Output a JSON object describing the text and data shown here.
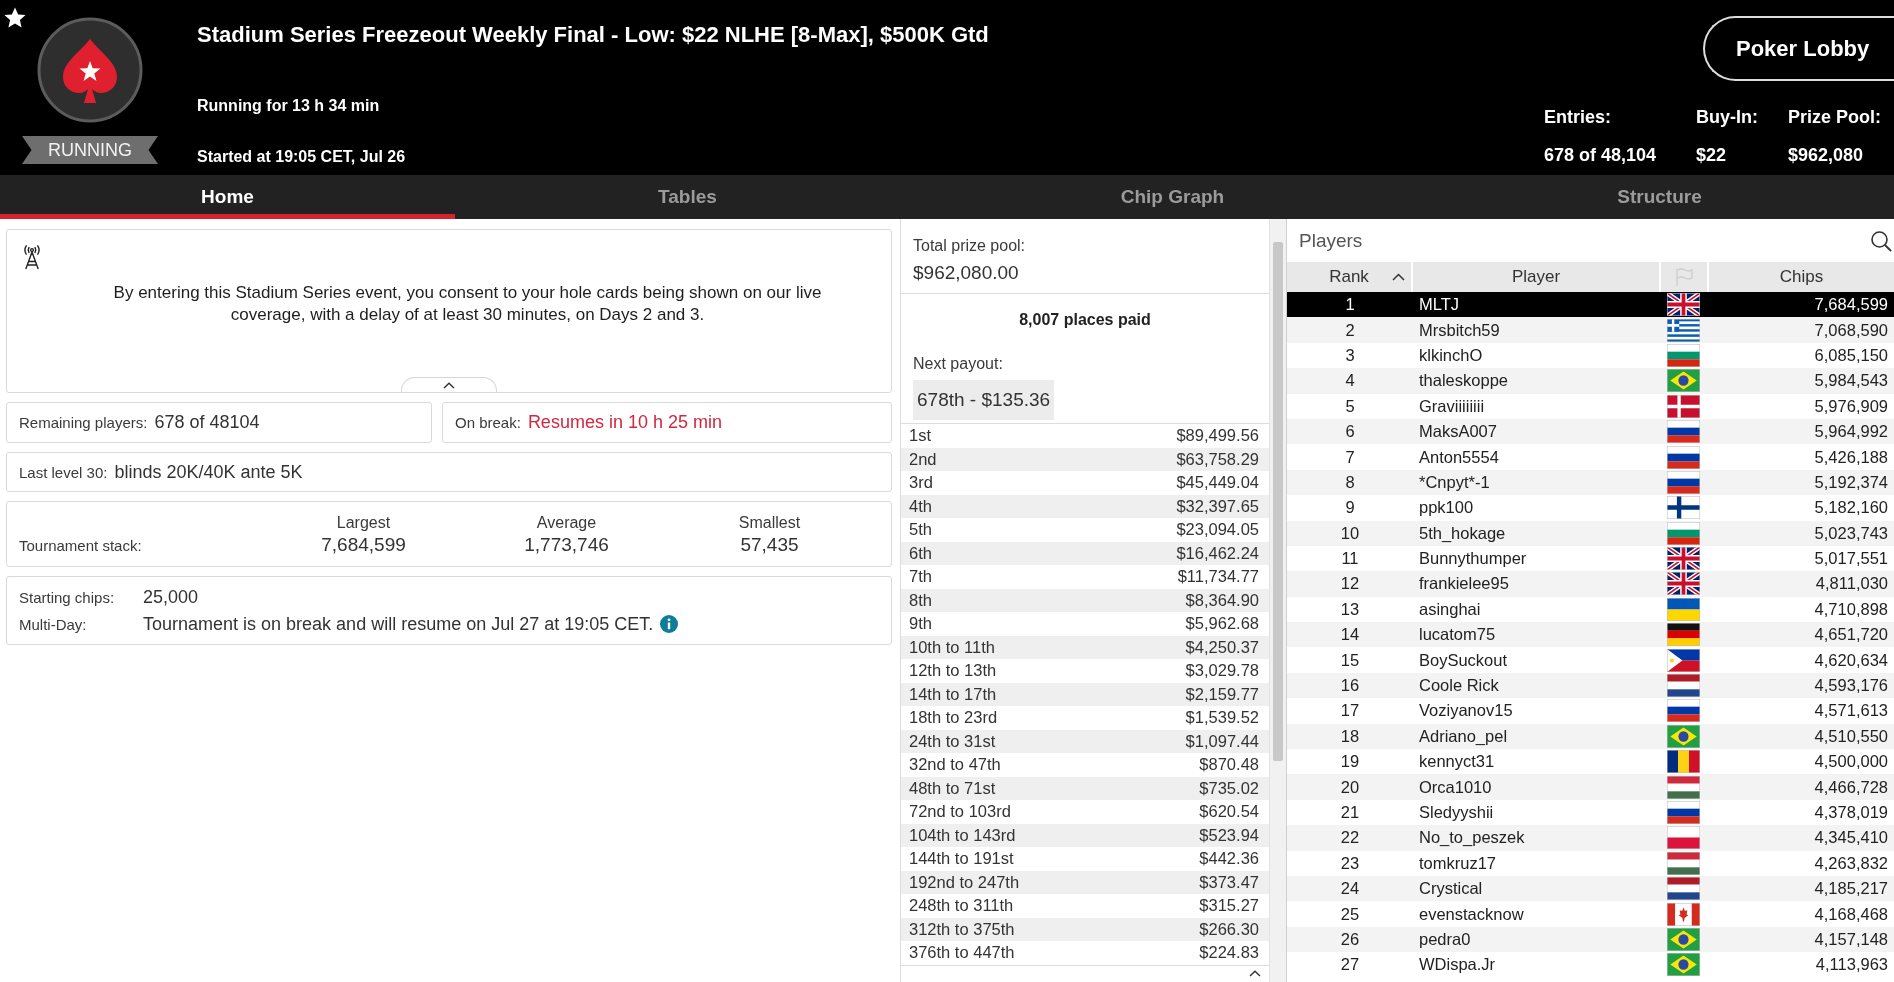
{
  "header": {
    "title": "Stadium Series Freezeout Weekly Final - Low: $22 NLHE [8-Max], $500K Gtd",
    "running_for": "Running for 13 h 34 min",
    "started_at": "Started at 19:05 CET, Jul 26",
    "status": "RUNNING",
    "lobby_button": "Poker Lobby",
    "stats": [
      {
        "label": "Entries:",
        "value": "678 of 48,104"
      },
      {
        "label": "Buy-In:",
        "value": "$22"
      },
      {
        "label": "Prize Pool:",
        "value": "$962,080"
      }
    ]
  },
  "tabs": [
    {
      "label": "Home",
      "selected": true
    },
    {
      "label": "Tables",
      "selected": false
    },
    {
      "label": "Chip Graph",
      "selected": false
    },
    {
      "label": "Structure",
      "selected": false
    }
  ],
  "home": {
    "notice": "By entering this Stadium Series event, you consent to your hole cards being shown on our live coverage, with a delay of at least 30 minutes, on Days 2 and 3.",
    "remaining": {
      "label": "Remaining players:",
      "value": "678 of 48104"
    },
    "break": {
      "label": "On break:",
      "value": "Resumes in 10 h 25 min"
    },
    "last_level": {
      "label": "Last level 30:",
      "value": "blinds 20K/40K ante 5K"
    },
    "stack": {
      "label": "Tournament stack:",
      "columns": [
        {
          "heading": "Largest",
          "value": "7,684,599"
        },
        {
          "heading": "Average",
          "value": "1,773,746"
        },
        {
          "heading": "Smallest",
          "value": "57,435"
        }
      ]
    },
    "details": [
      {
        "label": "Starting chips:",
        "value": "25,000",
        "info": false
      },
      {
        "label": "Multi-Day:",
        "value": "Tournament is on break and will resume on Jul 27 at 19:05 CET.",
        "info": true
      }
    ]
  },
  "payouts": {
    "total_label": "Total prize pool:",
    "total": "$962,080.00",
    "places_paid": "8,007 places paid",
    "next_label": "Next payout:",
    "next": "678th - $135.36",
    "rows": [
      {
        "place": "1st",
        "amount": "$89,499.56"
      },
      {
        "place": "2nd",
        "amount": "$63,758.29"
      },
      {
        "place": "3rd",
        "amount": "$45,449.04"
      },
      {
        "place": "4th",
        "amount": "$32,397.65"
      },
      {
        "place": "5th",
        "amount": "$23,094.05"
      },
      {
        "place": "6th",
        "amount": "$16,462.24"
      },
      {
        "place": "7th",
        "amount": "$11,734.77"
      },
      {
        "place": "8th",
        "amount": "$8,364.90"
      },
      {
        "place": "9th",
        "amount": "$5,962.68"
      },
      {
        "place": "10th to 11th",
        "amount": "$4,250.37"
      },
      {
        "place": "12th to 13th",
        "amount": "$3,029.78"
      },
      {
        "place": "14th to 17th",
        "amount": "$2,159.77"
      },
      {
        "place": "18th to 23rd",
        "amount": "$1,539.52"
      },
      {
        "place": "24th to 31st",
        "amount": "$1,097.44"
      },
      {
        "place": "32nd to 47th",
        "amount": "$870.48"
      },
      {
        "place": "48th to 71st",
        "amount": "$735.02"
      },
      {
        "place": "72nd to 103rd",
        "amount": "$620.54"
      },
      {
        "place": "104th to 143rd",
        "amount": "$523.94"
      },
      {
        "place": "144th to 191st",
        "amount": "$442.36"
      },
      {
        "place": "192nd to 247th",
        "amount": "$373.47"
      },
      {
        "place": "248th to 311th",
        "amount": "$315.27"
      },
      {
        "place": "312th to 375th",
        "amount": "$266.30"
      },
      {
        "place": "376th to 447th",
        "amount": "$224.83"
      }
    ]
  },
  "players": {
    "title": "Players",
    "columns": [
      {
        "kind": "text",
        "label": "Rank",
        "sorted": true
      },
      {
        "kind": "text",
        "label": "Player",
        "sorted": false
      },
      {
        "kind": "flag",
        "sorted": false
      },
      {
        "kind": "text",
        "label": "Chips",
        "sorted": false
      }
    ],
    "rows": [
      {
        "rank": "1",
        "player": "MLTJ",
        "flag": {
          "kind": "britain"
        },
        "chips": "7,684,599",
        "selected": true
      },
      {
        "rank": "2",
        "player": "Mrsbitch59",
        "flag": {
          "kind": "greece"
        },
        "chips": "7,068,590",
        "selected": false
      },
      {
        "rank": "3",
        "player": "klkinchO",
        "flag": {
          "kind": "bulgaria"
        },
        "chips": "6,085,150",
        "selected": false
      },
      {
        "rank": "4",
        "player": "thaleskoppe",
        "flag": {
          "kind": "brazil"
        },
        "chips": "5,984,543",
        "selected": false
      },
      {
        "rank": "5",
        "player": "Graviiiiiiii",
        "flag": {
          "kind": "denmark"
        },
        "chips": "5,976,909",
        "selected": false
      },
      {
        "rank": "6",
        "player": "MaksA007",
        "flag": {
          "kind": "russia"
        },
        "chips": "5,964,992",
        "selected": false
      },
      {
        "rank": "7",
        "player": "Anton5554",
        "flag": {
          "kind": "russia"
        },
        "chips": "5,426,188",
        "selected": false
      },
      {
        "rank": "8",
        "player": "*Cnpyt*-1",
        "flag": {
          "kind": "russia"
        },
        "chips": "5,192,374",
        "selected": false
      },
      {
        "rank": "9",
        "player": "ppk100",
        "flag": {
          "kind": "finland"
        },
        "chips": "5,182,160",
        "selected": false
      },
      {
        "rank": "10",
        "player": "5th_hokage",
        "flag": {
          "kind": "bulgaria"
        },
        "chips": "5,023,743",
        "selected": false
      },
      {
        "rank": "11",
        "player": "Bunnythumper",
        "flag": {
          "kind": "britain"
        },
        "chips": "5,017,551",
        "selected": false
      },
      {
        "rank": "12",
        "player": "frankielee95",
        "flag": {
          "kind": "britain"
        },
        "chips": "4,811,030",
        "selected": false
      },
      {
        "rank": "13",
        "player": "asinghai",
        "flag": {
          "kind": "ukraine"
        },
        "chips": "4,710,898",
        "selected": false
      },
      {
        "rank": "14",
        "player": "lucatom75",
        "flag": {
          "kind": "germany"
        },
        "chips": "4,651,720",
        "selected": false
      },
      {
        "rank": "15",
        "player": "BoySuckout",
        "flag": {
          "kind": "philippines"
        },
        "chips": "4,620,634",
        "selected": false
      },
      {
        "rank": "16",
        "player": "Coole Rick",
        "flag": {
          "kind": "netherlands"
        },
        "chips": "4,593,176",
        "selected": false
      },
      {
        "rank": "17",
        "player": "Voziyanov15",
        "flag": {
          "kind": "russia"
        },
        "chips": "4,571,613",
        "selected": false
      },
      {
        "rank": "18",
        "player": "Adriano_pel",
        "flag": {
          "kind": "brazil"
        },
        "chips": "4,510,550",
        "selected": false
      },
      {
        "rank": "19",
        "player": "kennyct31",
        "flag": {
          "kind": "romania"
        },
        "chips": "4,500,000",
        "selected": false
      },
      {
        "rank": "20",
        "player": "Orca1010",
        "flag": {
          "kind": "hungary"
        },
        "chips": "4,466,728",
        "selected": false
      },
      {
        "rank": "21",
        "player": "Sledyyshii",
        "flag": {
          "kind": "russia"
        },
        "chips": "4,378,019",
        "selected": false
      },
      {
        "rank": "22",
        "player": "No_to_peszek",
        "flag": {
          "kind": "poland"
        },
        "chips": "4,345,410",
        "selected": false
      },
      {
        "rank": "23",
        "player": "tomkruz17",
        "flag": {
          "kind": "hungary"
        },
        "chips": "4,263,832",
        "selected": false
      },
      {
        "rank": "24",
        "player": "Crystical",
        "flag": {
          "kind": "netherlands"
        },
        "chips": "4,185,217",
        "selected": false
      },
      {
        "rank": "25",
        "player": "evenstacknow",
        "flag": {
          "kind": "canada"
        },
        "chips": "4,168,468",
        "selected": false
      },
      {
        "rank": "26",
        "player": "pedra0",
        "flag": {
          "kind": "brazil"
        },
        "chips": "4,157,148",
        "selected": false
      },
      {
        "rank": "27",
        "player": "WDispa.Jr",
        "flag": {
          "kind": "brazil"
        },
        "chips": "4,113,963",
        "selected": false
      }
    ]
  }
}
